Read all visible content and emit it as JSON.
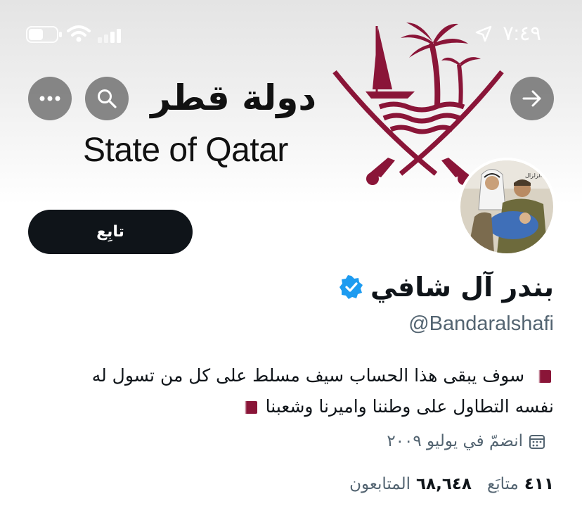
{
  "status_bar": {
    "time": "٧:٤٩",
    "icons": [
      "location-arrow-icon",
      "battery-icon",
      "wifi-icon",
      "signal-icon"
    ]
  },
  "header": {
    "back_icon": "arrow-right-icon",
    "search_icon": "search-icon",
    "more_icon": "more-icon"
  },
  "banner": {
    "logo_arabic": "دولة قطر",
    "logo_english": "State of Qatar",
    "emblem_color": "#8a1538",
    "avatar_caption": "بعد الزلزال"
  },
  "profile": {
    "follow_label": "تابِع",
    "display_name": "بندر آل شافي",
    "verified": true,
    "handle": "@Bandaralshafi",
    "bio_line1": "سوف يبقى هذا الحساب سيف مسلط على كل من تسول له",
    "bio_line2": "نفسه التطاول على وطننا واميرنا وشعبنا",
    "joined": "انضمّ في يوليو ٢٠٠٩",
    "following_count": "٤١١",
    "following_label": "متابَع",
    "followers_count": "٦٨,٦٤٨",
    "followers_label": "المتابعون"
  },
  "colors": {
    "follow_button_bg": "#0f1419",
    "verified_badge": "#1d9bf0",
    "secondary_text": "#536471",
    "qatar_maroon": "#8a1538"
  }
}
